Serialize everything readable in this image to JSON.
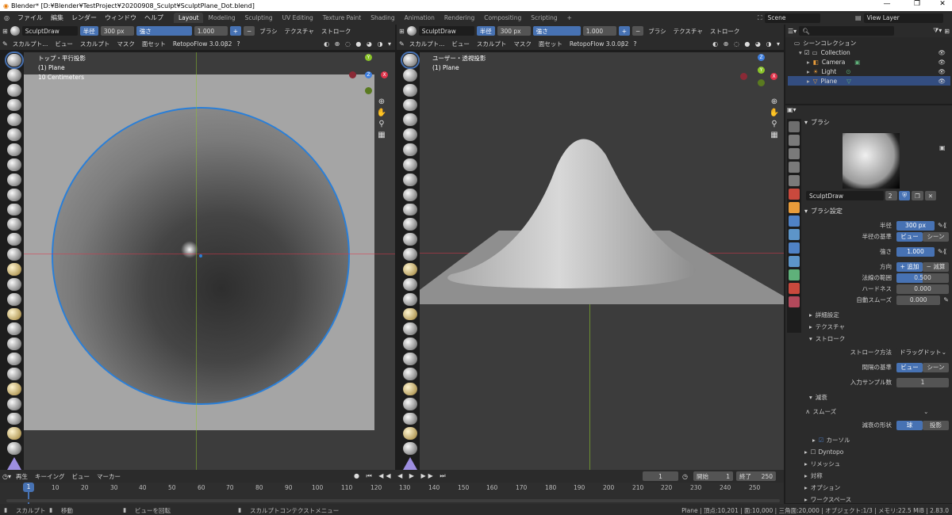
{
  "window": {
    "title": "Blender* [D:¥Blender¥TestProject¥20200908_Sculpt¥SculptPlane_Dot.blend]",
    "minimize": "—",
    "maximize": "❐",
    "close": "✕"
  },
  "menus": [
    "ファイル",
    "編集",
    "レンダー",
    "ウィンドウ",
    "ヘルプ"
  ],
  "workspaces": [
    "Layout",
    "Modeling",
    "Sculpting",
    "UV Editing",
    "Texture Paint",
    "Shading",
    "Animation",
    "Rendering",
    "Compositing",
    "Scripting"
  ],
  "workspaces_add": "+",
  "scene_label": "Scene",
  "view_layer_label": "View Layer",
  "viewport_header": {
    "brush_name": "SculptDraw",
    "radius_label": "半径",
    "radius_value": "300 px",
    "strength_label": "強さ",
    "strength_value": "1.000",
    "brush_menu": "ブラシ",
    "texture_menu": "テクスチャ",
    "stroke_menu": "ストローク",
    "plus": "+",
    "minus": "−"
  },
  "viewport_menu": {
    "mode": "スカルプト...",
    "items": [
      "ビュー",
      "スカルプト",
      "マスク",
      "面セット"
    ],
    "addon": "RetopoFlow 3.0.0β2"
  },
  "left_viewport": {
    "view_name": "トップ・平行投影",
    "object": "(1) Plane",
    "scale": "10 Centimeters"
  },
  "right_viewport": {
    "view_name": "ユーザー・透視投影",
    "object": "(1) Plane"
  },
  "gizmo": {
    "x": "X",
    "y": "Y",
    "z": "Z"
  },
  "outliner": {
    "root": "シーンコレクション",
    "collection": "Collection",
    "items": [
      "Camera",
      "Light",
      "Plane"
    ]
  },
  "properties": {
    "brush_panel": "ブラシ",
    "brush_name": "SculptDraw",
    "brush_users": "2",
    "brush_settings": "ブラシ設定",
    "radius_label": "半径",
    "radius_value": "300 px",
    "radius_ref_label": "半径の基準",
    "radius_ref_options": [
      "ビュー",
      "シーン"
    ],
    "strength_label": "強さ",
    "strength_value": "1.000",
    "direction_label": "方向",
    "direction_options": [
      "+ 追加",
      "− 減算"
    ],
    "normal_radius_label": "法線の範囲",
    "normal_radius_value": "0.500",
    "hardness_label": "ハードネス",
    "hardness_value": "0.000",
    "autosmooth_label": "自動スムーズ",
    "autosmooth_value": "0.000",
    "advanced": "詳細設定",
    "texture": "テクスチャ",
    "stroke": "ストローク",
    "stroke_method_label": "ストローク方法",
    "stroke_method_value": "ドラッグドット",
    "spacing_ref_label": "間隔の基準",
    "spacing_ref_options": [
      "ビュー",
      "シーン"
    ],
    "input_samples_label": "入力サンプル数",
    "input_samples_value": "1",
    "falloff": "減衰",
    "smooth": "スムーズ",
    "falloff_shape_label": "減衰の形状",
    "falloff_shape_options": [
      "球",
      "投影"
    ],
    "cursor": "カーソル",
    "dyntopo": "Dyntopo",
    "remesh": "リメッシュ",
    "symmetry": "対称",
    "options": "オプション",
    "workspace": "ワークスペース"
  },
  "timeline": {
    "menus": [
      "再生",
      "キーイング",
      "ビュー",
      "マーカー"
    ],
    "current_frame": "1",
    "start_label": "開始",
    "start_value": "1",
    "end_label": "終了",
    "end_value": "250",
    "ticks": [
      "1",
      "10",
      "20",
      "30",
      "40",
      "50",
      "60",
      "70",
      "80",
      "90",
      "100",
      "110",
      "120",
      "130",
      "140",
      "150",
      "160",
      "170",
      "180",
      "190",
      "200",
      "210",
      "220",
      "230",
      "240",
      "250"
    ]
  },
  "status": {
    "left1": "スカルプト",
    "left2": "移動",
    "left3": "ビューを回転",
    "left4": "スカルプトコンテクストメニュー",
    "right": "Plane | 頂点:10,201 | 面:10,000 | 三角面:20,000 | オブジェクト:1/3 | メモリ:22.5 MiB | 2.83.0"
  },
  "colors": {
    "accent": "#4772b3",
    "background": "#1d1d1d",
    "header": "#2b2b2b",
    "brush_circle": "#2a7fd8",
    "axis_x": "#e0334a",
    "axis_y": "#8bc52a",
    "axis_z": "#3f7fde"
  }
}
